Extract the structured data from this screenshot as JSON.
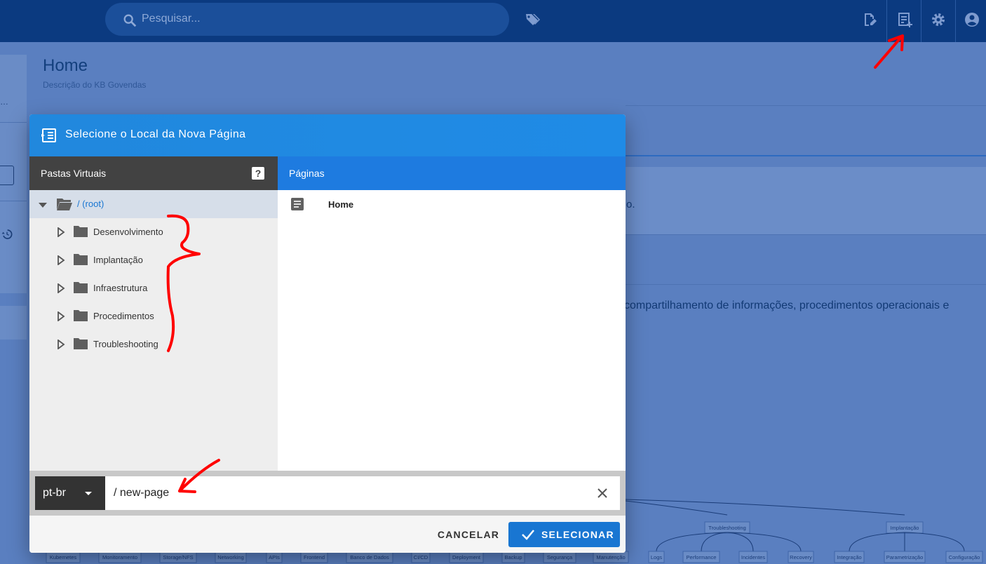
{
  "topbar": {
    "search_placeholder": "Pesquisar...",
    "icons": [
      "search-icon",
      "tag-icon",
      "edit-page-icon",
      "new-page-icon",
      "settings-icon",
      "account-icon"
    ]
  },
  "page": {
    "title": "Home",
    "description": "Descrição do KB Govendas",
    "body_text": "compartilhamento de informações, procedimentos operacionais e",
    "panel_text": "o."
  },
  "dialog": {
    "title": "Selecione o Local da Nova Página",
    "folders_header": "Pastas Virtuais",
    "help_label": "?",
    "pages_header": "Páginas",
    "root_label": "/ (root)",
    "folders": [
      {
        "label": "Desenvolvimento"
      },
      {
        "label": "Implantação"
      },
      {
        "label": "Infraestrutura"
      },
      {
        "label": "Procedimentos"
      },
      {
        "label": "Troubleshooting"
      }
    ],
    "pages": [
      {
        "label": "Home"
      }
    ],
    "locale": "pt-br",
    "path_value": "/ new-page",
    "cancel_label": "CANCELAR",
    "select_label": "SELECIONAR"
  },
  "diagram": {
    "top_nodes": [
      "Troubleshooting",
      "Implantação"
    ],
    "bottom_nodes": [
      "Kubernetes",
      "Monitoramento",
      "Storage/NFS",
      "Networking",
      "APIs",
      "Frontend",
      "Banco de Dados",
      "CI/CD",
      "Deployment",
      "Backup",
      "Segurança",
      "Manutenção",
      "Logs",
      "Performance",
      "Incidentes",
      "Recovery",
      "Integração",
      "Parametrização",
      "Configuração"
    ]
  },
  "colors": {
    "topbar": "#0b3a80",
    "dialog_header": "#2188dd",
    "pages_header": "#1e7be0",
    "folders_header": "#424242",
    "primary_button": "#1976d2",
    "annotation": "#ff0000"
  }
}
